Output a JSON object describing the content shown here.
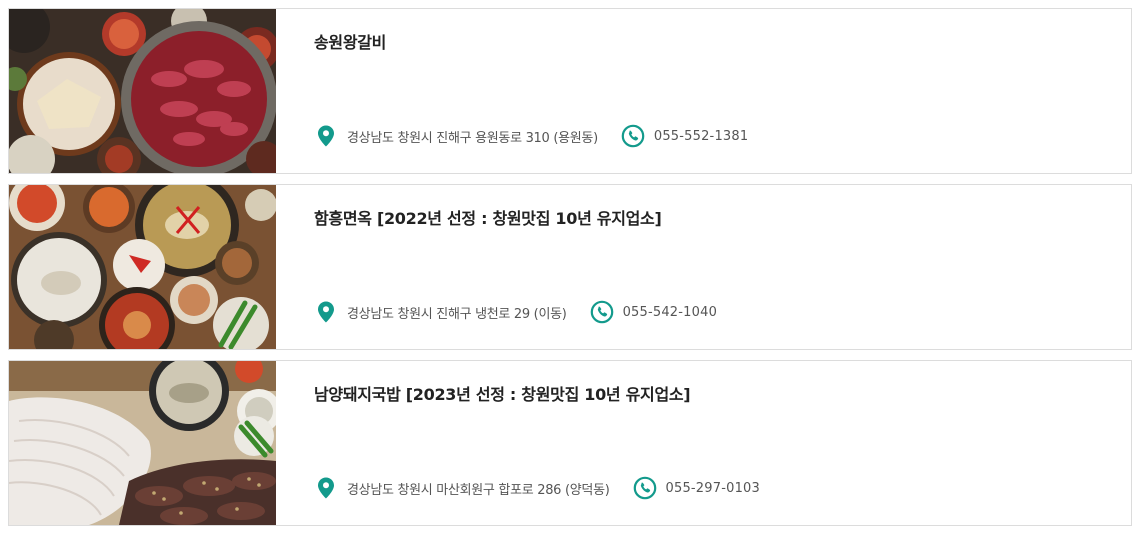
{
  "accent_color": "#139a8c",
  "restaurants": [
    {
      "name": "송원왕갈비",
      "address": "경상남도 창원시 진해구 용원동로 310 (용원동)",
      "phone": "055-552-1381",
      "image_alt": "galbi-grill-photo"
    },
    {
      "name": "함흥면옥 [2022년 선정 : 창원맛집 10년 유지업소]",
      "address": "경상남도 창원시 진해구 냉천로 29 (이동)",
      "phone": "055-542-1040",
      "image_alt": "naengmyeon-table-photo"
    },
    {
      "name": "남양돼지국밥 [2023년 선정 : 창원맛집 10년 유지업소]",
      "address": "경상남도 창원시 마산회원구 합포로 286 (양덕동)",
      "phone": "055-297-0103",
      "image_alt": "pork-gukbap-sundae-photo"
    }
  ],
  "icons": {
    "location": "map-pin-icon",
    "phone": "phone-icon"
  }
}
